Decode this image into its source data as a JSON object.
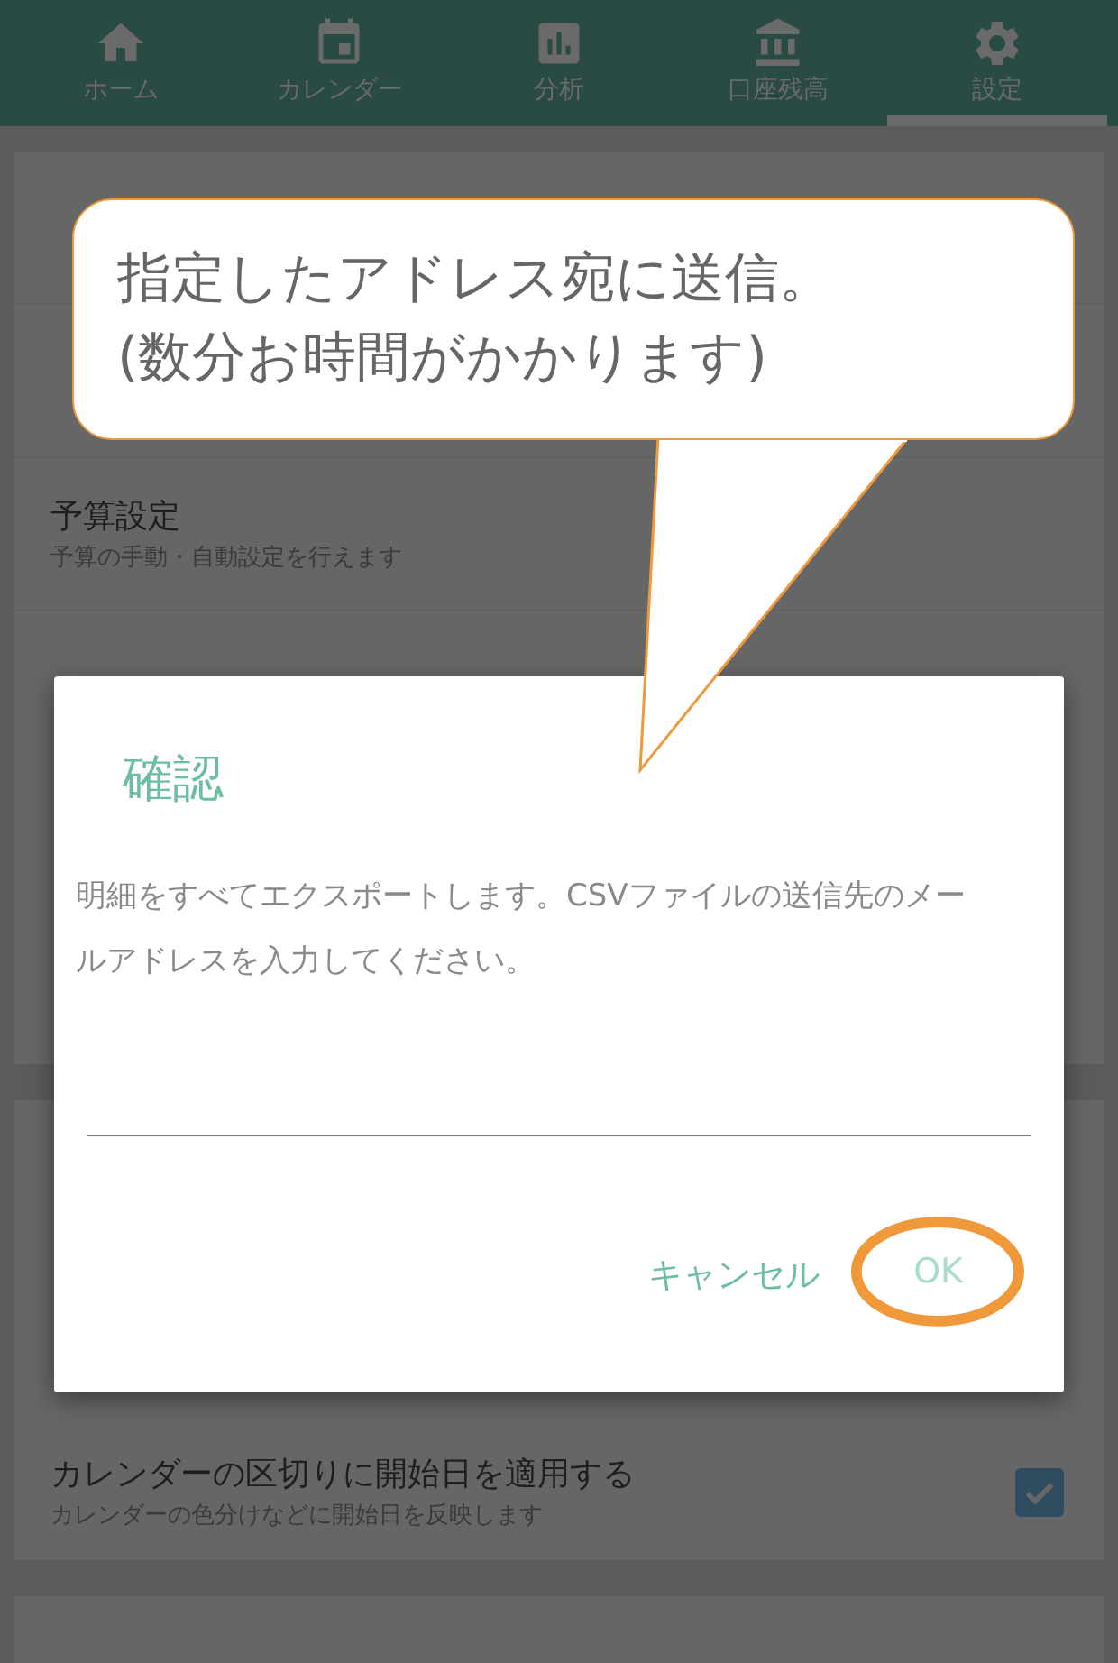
{
  "tabs": [
    {
      "label": "ホーム",
      "selected": false
    },
    {
      "label": "カレンダー",
      "selected": false
    },
    {
      "label": "分析",
      "selected": false
    },
    {
      "label": "口座残高",
      "selected": false
    },
    {
      "label": "設定",
      "selected": true
    }
  ],
  "settings": [
    {
      "title": "予算設定",
      "subtitle": "予算の手動・自動設定を行えます"
    }
  ],
  "calendar_setting": {
    "title": "カレンダーの区切りに開始日を適用する",
    "subtitle": "カレンダーの色分けなどに開始日を反映します",
    "checked": true
  },
  "dialog": {
    "title": "確認",
    "message": "明細をすべてエクスポートします。CSVファイルの送信先のメールアドレスを入力してください。",
    "buttons": [
      {
        "label": "キャンセル",
        "disabled": false,
        "highlighted": false
      },
      {
        "label": "OK",
        "disabled": true,
        "highlighted": true
      }
    ]
  },
  "callout": {
    "lines": [
      "指定したアドレス宛に送信。",
      "(数分お時間がかかります)"
    ]
  }
}
